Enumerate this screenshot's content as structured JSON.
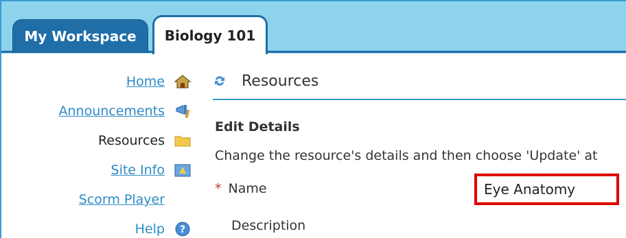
{
  "tabs": [
    {
      "label": "My Workspace",
      "active": false
    },
    {
      "label": "Biology 101",
      "active": true
    }
  ],
  "nav": {
    "items": [
      {
        "label": "Home",
        "icon": "home-icon",
        "link": true
      },
      {
        "label": "Announcements",
        "icon": "megaphone-icon",
        "link": true
      },
      {
        "label": "Resources",
        "icon": "folder-icon",
        "link": false
      },
      {
        "label": "Site Info",
        "icon": "site-info-icon",
        "link": true
      },
      {
        "label": "Scorm Player",
        "icon": "",
        "link": true
      },
      {
        "label": "Help",
        "icon": "help-icon",
        "link": true
      }
    ]
  },
  "main": {
    "title": "Resources",
    "icon": "refresh-icon",
    "section_title": "Edit Details",
    "instructions": "Change the resource's details and then choose 'Update' at",
    "fields": {
      "name_label": "Name",
      "name_value": "Eye Anatomy",
      "required_marker": "*",
      "description_label": "Description"
    }
  },
  "colors": {
    "tab_bar": "#8ed3ec",
    "tab_blue": "#1f6ea8",
    "link": "#2d8bc6",
    "highlight": "#e00000"
  }
}
